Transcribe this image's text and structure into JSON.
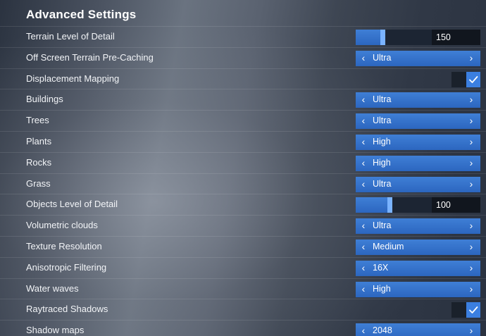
{
  "title": "Advanced Settings",
  "colors": {
    "accent": "#3b7fe0",
    "selector": "#2f6cc6",
    "slider_value_bg": "#11161e"
  },
  "icons": {
    "left": "chevron-left-icon",
    "right": "chevron-right-icon",
    "check": "checkmark-icon"
  },
  "rows": [
    {
      "label": "Terrain Level of Detail",
      "type": "slider",
      "value": "150",
      "fraction": 0.36
    },
    {
      "label": "Off Screen Terrain Pre-Caching",
      "type": "select",
      "value": "Ultra"
    },
    {
      "label": "Displacement Mapping",
      "type": "checkbox",
      "checked": true
    },
    {
      "label": "Buildings",
      "type": "select",
      "value": "Ultra"
    },
    {
      "label": "Trees",
      "type": "select",
      "value": "Ultra"
    },
    {
      "label": "Plants",
      "type": "select",
      "value": "High"
    },
    {
      "label": "Rocks",
      "type": "select",
      "value": "High"
    },
    {
      "label": "Grass",
      "type": "select",
      "value": "Ultra"
    },
    {
      "label": "Objects Level of Detail",
      "type": "slider",
      "value": "100",
      "fraction": 0.45
    },
    {
      "label": "Volumetric clouds",
      "type": "select",
      "value": "Ultra"
    },
    {
      "label": "Texture Resolution",
      "type": "select",
      "value": "Medium"
    },
    {
      "label": "Anisotropic Filtering",
      "type": "select",
      "value": "16X"
    },
    {
      "label": "Water waves",
      "type": "select",
      "value": "High"
    },
    {
      "label": "Raytraced Shadows",
      "type": "checkbox",
      "checked": true
    },
    {
      "label": "Shadow maps",
      "type": "select",
      "value": "2048"
    }
  ]
}
